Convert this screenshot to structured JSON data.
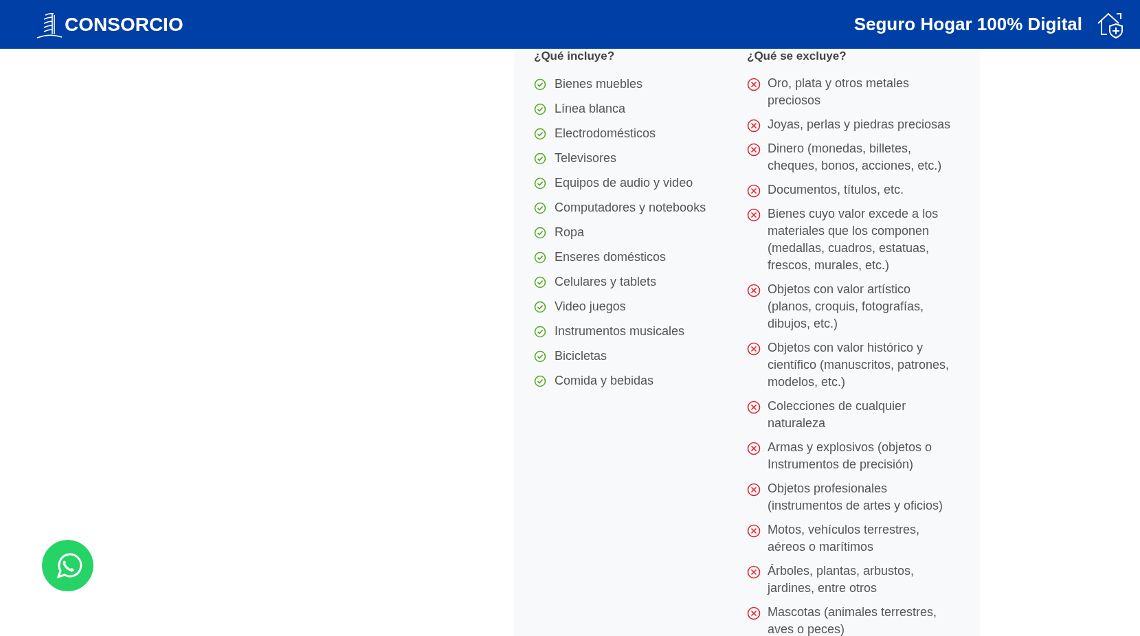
{
  "header": {
    "brand": "CONSORCIO",
    "title": "Seguro Hogar 100% Digital"
  },
  "includes": {
    "heading": "¿Qué incluye?",
    "items": [
      "Bienes muebles",
      "Línea blanca",
      "Electrodomésticos",
      "Televisores",
      "Equipos de audio y video",
      "Computadores y notebooks",
      "Ropa",
      "Enseres domésticos",
      "Celulares y tablets",
      "Video juegos",
      "Instrumentos musicales",
      "Bicicletas",
      "Comida y bebidas"
    ]
  },
  "excludes": {
    "heading": "¿Qué se excluye?",
    "items": [
      "Oro, plata y otros metales preciosos",
      "Joyas, perlas y piedras preciosas",
      "Dinero (monedas, billetes, cheques, bonos, acciones, etc.)",
      "Documentos, títulos, etc.",
      "Bienes cuyo valor excede a los materiales que los componen (medallas, cuadros, estatuas, frescos, murales, etc.)",
      "Objetos con valor artístico (planos, croquis, fotografías, dibujos, etc.)",
      "Objetos con valor histórico y científico (manuscritos, patrones, modelos, etc.)",
      "Colecciones de cualquier naturaleza",
      "Armas y explosivos (objetos o Instrumentos de precisión)",
      "Objetos profesionales (instrumentos de artes y oficios)",
      "Motos, vehículos terrestres, aéreos o marítimos",
      "Árboles, plantas, arbustos, jardines, entre otros",
      "Mascotas (animales terrestres, aves o peces)"
    ]
  }
}
